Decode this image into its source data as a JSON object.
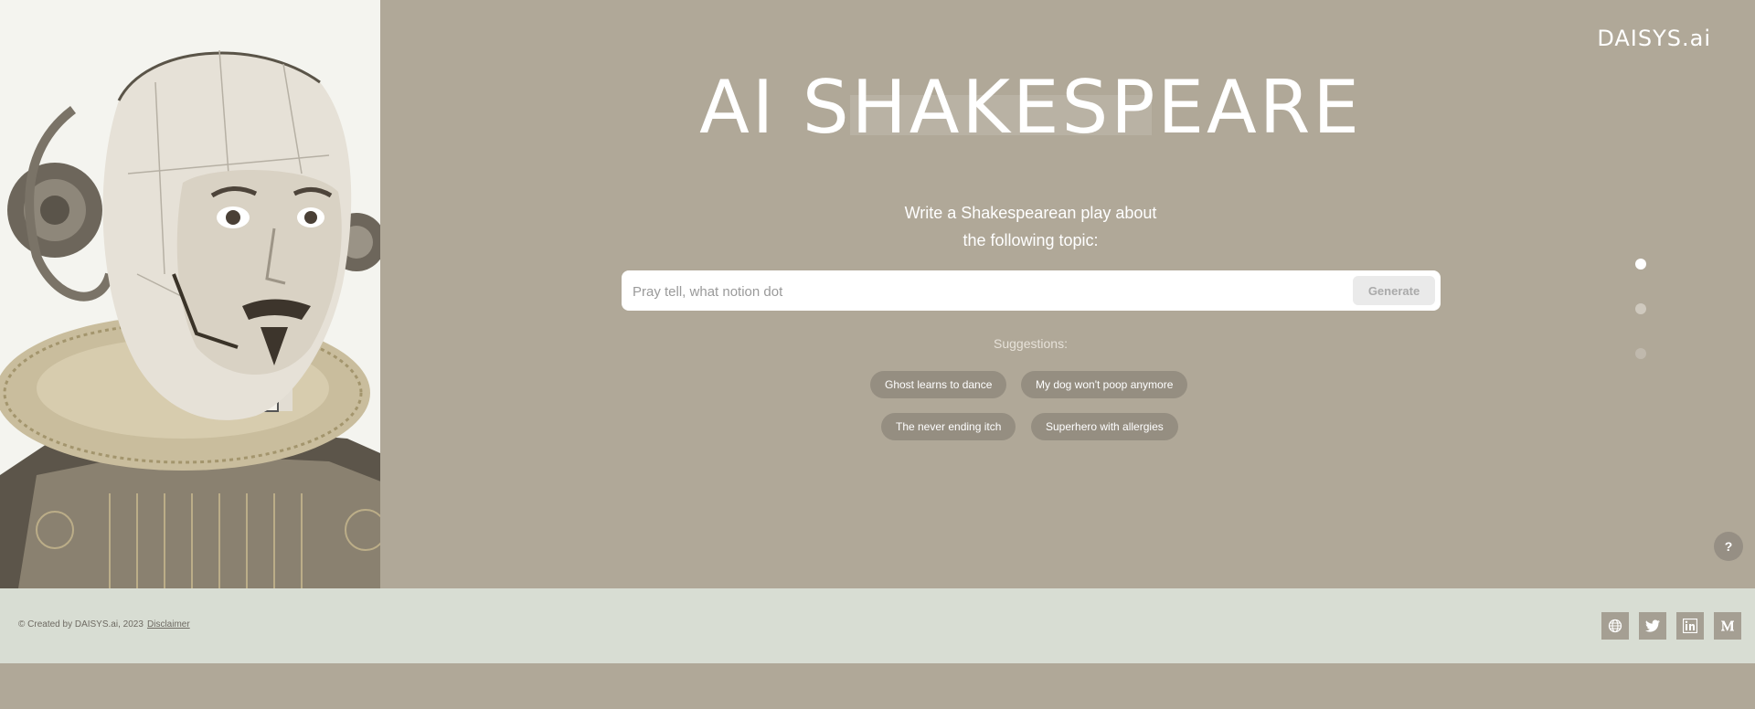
{
  "brand": {
    "logo": "DAISYS.ai"
  },
  "hero": {
    "title": "AI SHAKESPEARE",
    "prompt_line1": "Write a Shakespearean play about",
    "prompt_line2": "the following topic:",
    "input_placeholder": "Pray tell, what notion dot",
    "generate_label": "Generate",
    "suggestions_label": "Suggestions:",
    "suggestions": [
      "Ghost learns to dance",
      "My dog won't poop anymore",
      "The never ending itch",
      "Superhero with allergies"
    ]
  },
  "pager": {
    "active_index": 0,
    "count": 3
  },
  "help": {
    "label": "?"
  },
  "footer": {
    "copyright": "© Created by DAISYS.ai, 2023",
    "disclaimer": "Disclaimer",
    "social_icons": [
      "globe-icon",
      "twitter-icon",
      "linkedin-icon",
      "medium-icon"
    ]
  },
  "colors": {
    "background": "#b0a898",
    "footer": "#d8ddd3",
    "chip": "#958e81",
    "portrait_panel": "#f4f4ef"
  }
}
